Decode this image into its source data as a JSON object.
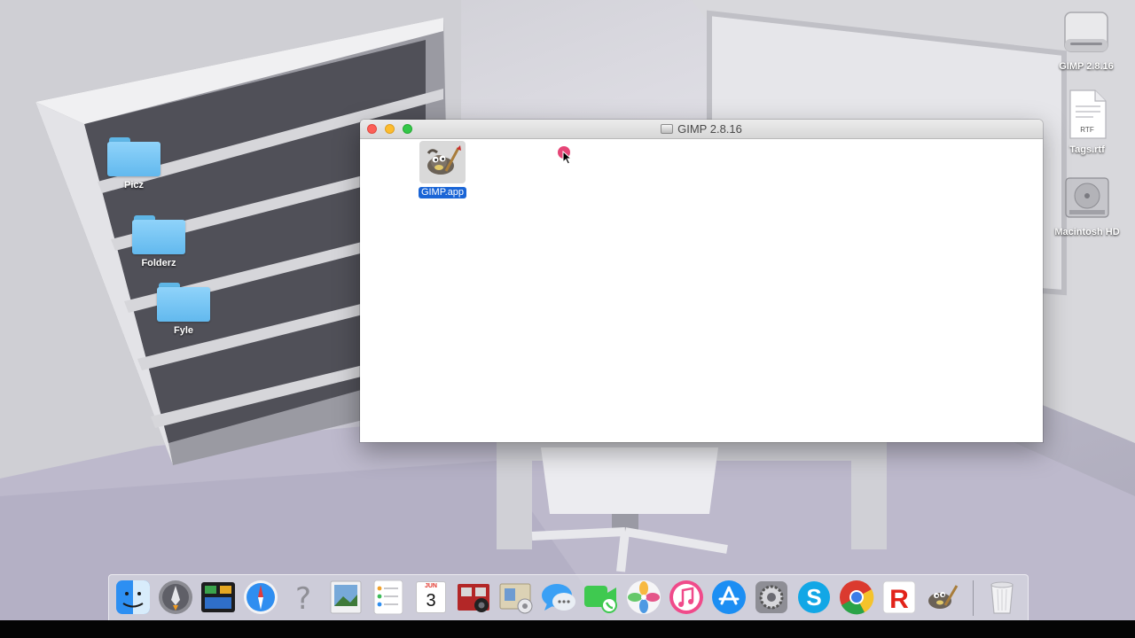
{
  "window": {
    "title": "GIMP 2.8.16",
    "item": {
      "label": "GIMP.app"
    }
  },
  "desktop": {
    "folders": [
      {
        "label": "Picz"
      },
      {
        "label": "Folderz"
      },
      {
        "label": "Fyle"
      }
    ],
    "right_items": [
      {
        "label": "GIMP 2.8.16",
        "icon": "disk-image-icon"
      },
      {
        "label": "Tags.rtf",
        "icon": "rtf-document-icon",
        "badge": "RTF"
      },
      {
        "label": "Macintosh HD",
        "icon": "hard-drive-icon"
      }
    ]
  },
  "dock": {
    "items": [
      "finder-icon",
      "launchpad-icon",
      "mission-control-icon",
      "safari-icon",
      "unknown-app-icon",
      "preview-icon",
      "reminders-icon",
      "calendar-icon",
      "photo-booth-icon",
      "contacts-icon",
      "messages-icon",
      "facetime-icon",
      "photos-icon",
      "itunes-icon",
      "app-store-icon",
      "system-preferences-icon",
      "skype-icon",
      "chrome-icon",
      "roblox-icon",
      "gimp-icon",
      "trash-icon"
    ],
    "calendar": {
      "month": "JUN",
      "day": "3"
    }
  },
  "colors": {
    "selection": "#1a65d6",
    "folder": "#74c5f4",
    "close": "#fc5f57",
    "minimize": "#fdbc2e",
    "maximize": "#33c748"
  }
}
